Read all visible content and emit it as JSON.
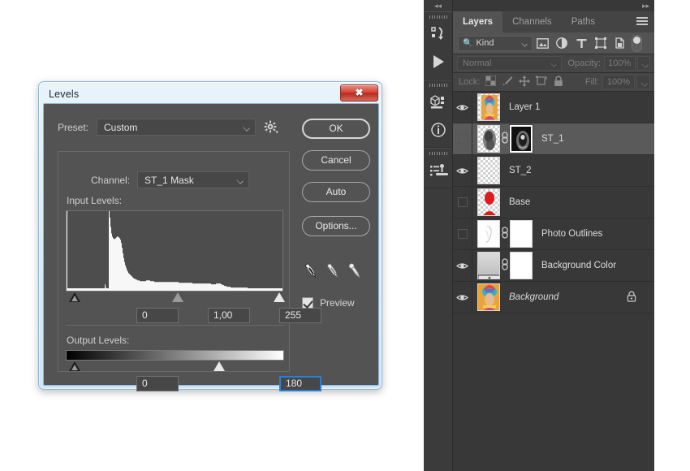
{
  "dialog": {
    "title": "Levels",
    "close_label": "✖",
    "preset_label": "Preset:",
    "preset_value": "Custom",
    "gear_icon": "gear-icon",
    "channel_label": "Channel:",
    "channel_value": "ST_1 Mask",
    "input_levels_label": "Input Levels:",
    "input_shadow": "0",
    "input_gamma": "1,00",
    "input_highlight": "255",
    "output_levels_label": "Output Levels:",
    "output_shadow": "0",
    "output_highlight": "180",
    "buttons": {
      "ok": "OK",
      "cancel": "Cancel",
      "auto": "Auto",
      "options": "Options..."
    },
    "eyedroppers": [
      "black-point-eyedropper",
      "gray-point-eyedropper",
      "white-point-eyedropper"
    ],
    "preview_label": "Preview",
    "preview_checked": true,
    "accent_focus_color": "#2a7fd4",
    "close_button_color": "#c9392a"
  },
  "histogram": {
    "description": "Input levels histogram for ST_1 Mask channel",
    "bins": [
      100,
      3,
      3,
      3,
      3,
      3,
      3,
      3,
      3,
      3,
      3,
      3,
      3,
      3,
      3,
      3,
      3,
      3,
      3,
      3,
      3,
      3,
      3,
      3,
      3,
      3,
      3,
      3,
      3,
      3,
      3,
      3,
      3,
      3,
      3,
      3,
      3,
      3,
      3,
      3,
      3,
      3,
      3,
      3,
      3,
      3,
      3,
      8,
      4,
      3,
      3,
      3,
      100,
      92,
      80,
      72,
      68,
      66,
      65,
      65,
      66,
      67,
      68,
      68,
      67,
      66,
      64,
      60,
      54,
      47,
      41,
      36,
      32,
      29,
      26,
      24,
      22,
      21,
      20,
      19,
      18,
      17,
      16,
      15,
      15,
      14,
      14,
      13,
      13,
      13,
      12,
      12,
      12,
      12,
      12,
      12,
      12,
      12,
      13,
      13,
      13,
      13,
      13,
      12,
      12,
      12,
      12,
      12,
      11,
      11,
      11,
      11,
      11,
      11,
      11,
      11,
      11,
      11,
      11,
      11,
      11,
      11,
      11,
      11,
      11,
      11,
      11,
      11,
      11,
      11,
      11,
      11,
      11,
      11,
      11,
      11,
      11,
      11,
      10,
      10,
      10,
      10,
      10,
      10,
      10,
      10,
      10,
      10,
      10,
      10,
      10,
      10,
      10,
      10,
      10,
      9,
      9,
      9,
      9,
      9,
      9,
      9,
      9,
      9,
      9,
      9,
      9,
      9,
      9,
      9,
      9,
      9,
      9,
      9,
      9,
      9,
      9,
      9,
      8,
      8,
      8,
      8,
      8,
      8,
      9,
      9,
      9,
      9,
      9,
      9,
      8,
      8,
      7,
      7,
      6,
      6,
      6,
      5,
      5,
      5,
      5,
      5,
      4,
      4,
      4,
      4,
      4,
      4,
      4,
      4,
      4,
      4,
      4,
      4,
      4,
      4,
      4,
      4,
      4,
      4,
      4,
      4,
      4,
      3,
      3,
      3,
      3,
      3,
      3,
      3,
      3,
      3,
      3,
      3,
      3,
      3,
      3,
      3,
      3,
      3,
      3,
      3,
      3,
      3,
      3,
      3,
      3,
      3,
      3,
      3,
      3,
      3,
      3,
      3,
      3,
      3,
      3,
      3,
      3,
      3,
      3,
      3,
      3,
      3,
      3,
      3
    ]
  },
  "panel": {
    "collapse_icon": "collapse-panel-icon",
    "expand_icon": "expand-panel-icon",
    "rail_items": [
      {
        "name": "history-panel-icon"
      },
      {
        "name": "actions-play-icon"
      },
      {
        "name": "properties-3d-icon"
      },
      {
        "name": "info-panel-icon"
      },
      {
        "name": "adjustments-clone-icon"
      }
    ],
    "tabs": [
      {
        "label": "Layers",
        "active": true
      },
      {
        "label": "Channels",
        "active": false
      },
      {
        "label": "Paths",
        "active": false
      }
    ],
    "menu_icon": "panel-menu-icon",
    "filter": {
      "search_icon": "search-icon",
      "kind_label": "Kind",
      "icons": [
        "pixel-layer-filter-icon",
        "adjustment-layer-filter-icon",
        "type-layer-filter-icon",
        "shape-layer-filter-icon",
        "smart-object-filter-icon"
      ],
      "toggle_icon": "filter-toggle-switch"
    },
    "blend_mode": "Normal",
    "opacity_label": "Opacity:",
    "opacity_value": "100%",
    "lock_label": "Lock:",
    "lock_icons": [
      "lock-transparent-pixels-icon",
      "lock-image-pixels-icon",
      "lock-position-icon",
      "lock-artboard-nesting-icon",
      "lock-all-icon"
    ],
    "fill_label": "Fill:",
    "fill_value": "100%",
    "layers": [
      {
        "name": "Layer 1",
        "visible": true,
        "selected": false,
        "thumb": "portrait",
        "has_mask": false,
        "mask_selected": false,
        "locked": false,
        "italic": false
      },
      {
        "name": "ST_1",
        "visible": false,
        "selected": true,
        "thumb": "smoke",
        "has_mask": true,
        "mask_kind": "dark",
        "mask_selected": true,
        "locked": false,
        "italic": false
      },
      {
        "name": "ST_2",
        "visible": true,
        "selected": false,
        "thumb": "checker",
        "has_mask": false,
        "mask_selected": false,
        "locked": false,
        "italic": false
      },
      {
        "name": "Base",
        "visible": false,
        "selected": false,
        "thumb": "red-silhouette",
        "has_mask": false,
        "mask_selected": false,
        "locked": false,
        "italic": false
      },
      {
        "name": "Photo Outlines",
        "visible": false,
        "selected": false,
        "thumb": "sketch",
        "has_mask": true,
        "mask_kind": "white",
        "mask_selected": false,
        "locked": false,
        "italic": false
      },
      {
        "name": "Background Color",
        "visible": true,
        "selected": false,
        "thumb": "gradient-fill",
        "has_mask": true,
        "mask_kind": "white",
        "mask_selected": false,
        "locked": false,
        "italic": false
      },
      {
        "name": "Background",
        "visible": true,
        "selected": false,
        "thumb": "portrait-full",
        "has_mask": false,
        "mask_selected": false,
        "locked": true,
        "lock_icon": "lock-icon",
        "italic": true
      }
    ]
  }
}
